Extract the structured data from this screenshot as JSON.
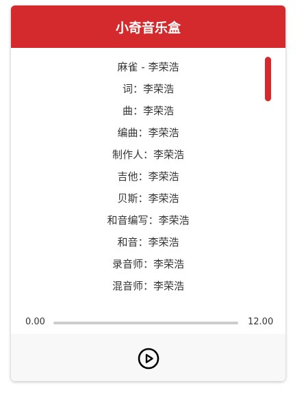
{
  "header": {
    "title": "小奇音乐盒"
  },
  "lyrics": [
    "麻雀 - 李荣浩",
    "词：李荣浩",
    "曲：李荣浩",
    "编曲：李荣浩",
    "制作人：李荣浩",
    "吉他：李荣浩",
    "贝斯：李荣浩",
    "和音编写：李荣浩",
    "和音：李荣浩",
    "录音师：李荣浩",
    "混音师：李荣浩"
  ],
  "player": {
    "current_time": "0.00",
    "total_time": "12.00",
    "progress_fraction": 0,
    "play_icon": "play-circle-icon"
  },
  "colors": {
    "accent": "#d42a2e",
    "track": "#cccccc",
    "controls_bg": "#f8f8f8"
  }
}
